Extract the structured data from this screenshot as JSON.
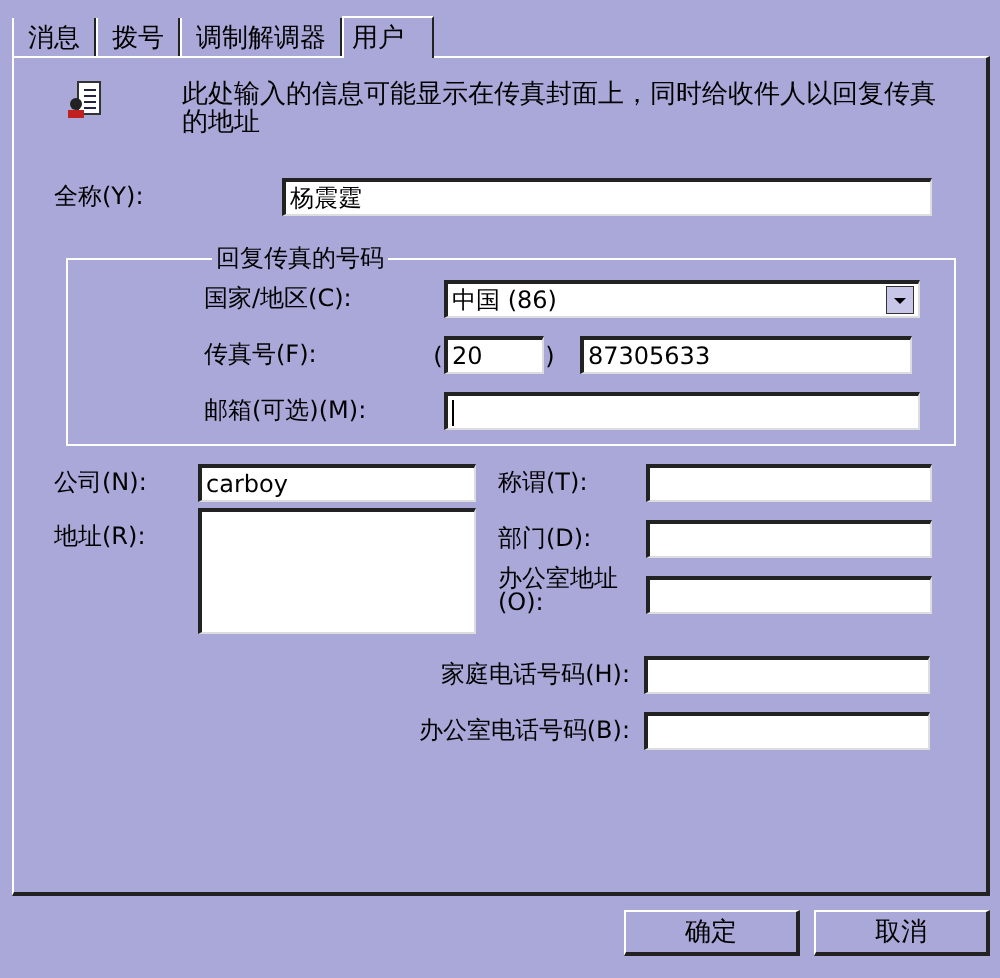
{
  "tabs": [
    {
      "label": "消息",
      "selected": false
    },
    {
      "label": "拨号",
      "selected": false
    },
    {
      "label": "调制解调器",
      "selected": false
    },
    {
      "label": "用户",
      "selected": true
    }
  ],
  "description": "此处输入的信息可能显示在传真封面上，同时给收件人以回复传真的地址",
  "full_name": {
    "label": "全称(Y):",
    "value": "杨震霆"
  },
  "reply_fax": {
    "title": "回复传真的号码",
    "country": {
      "label": "国家/地区(C):",
      "value": "中国 (86)"
    },
    "fax": {
      "label": "传真号(F):",
      "open": "(",
      "area_code": "20",
      "close": ")",
      "number": "87305633"
    },
    "mailbox": {
      "label": "邮箱(可选)(M):",
      "focused": true
    }
  },
  "company": {
    "label": "公司(N):",
    "value": "carboy"
  },
  "address": {
    "label": "地址(R):"
  },
  "title": {
    "label": "称谓(T):"
  },
  "department": {
    "label": "部门(D):"
  },
  "office_address": {
    "label": "办公室地址(O):"
  },
  "home_phone": {
    "label": "家庭电话号码(H):"
  },
  "office_phone": {
    "label": "办公室电话号码(B):"
  },
  "buttons": [
    {
      "label": "确定"
    },
    {
      "label": "取消"
    }
  ]
}
